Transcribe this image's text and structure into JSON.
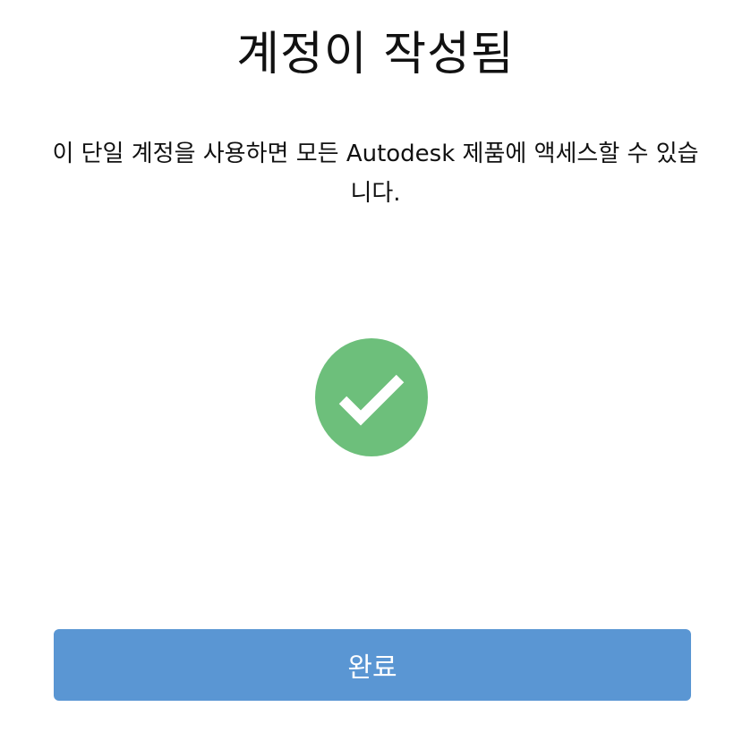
{
  "dialog": {
    "title": "계정이 작성됨",
    "description": "이 단일 계정을 사용하면 모든 Autodesk 제품에 액세스할 수 있습니다.",
    "status_icon": "success-check-icon",
    "done_label": "완료"
  },
  "colors": {
    "success_green": "#6dbf7b",
    "button_blue": "#5a96d3",
    "button_text": "#ffffff"
  }
}
